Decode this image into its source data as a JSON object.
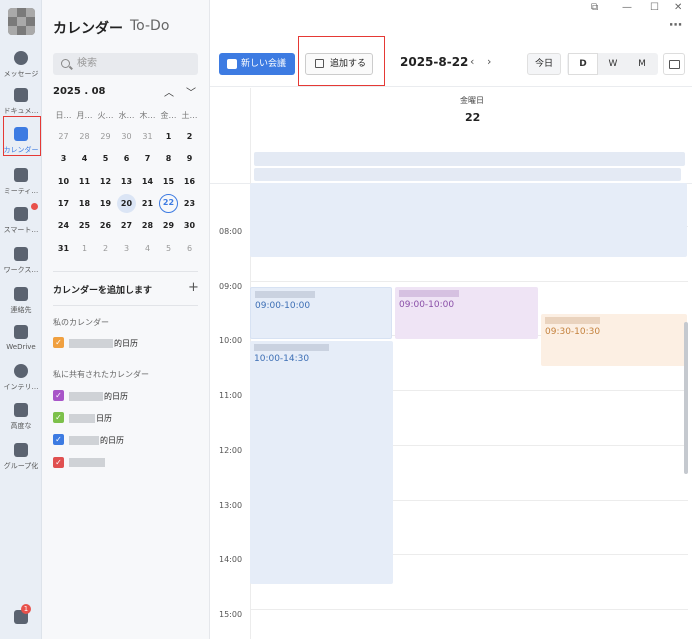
{
  "sidebar_rail": {
    "items": [
      {
        "label": "メッセージ",
        "icon": "chat-icon"
      },
      {
        "label": "ドキュメ…",
        "icon": "document-icon"
      },
      {
        "label": "カレンダー",
        "icon": "calendar-icon"
      },
      {
        "label": "ミーティ…",
        "icon": "meeting-icon"
      },
      {
        "label": "スマート…",
        "icon": "smart-icon"
      },
      {
        "label": "ワークス…",
        "icon": "workspace-icon"
      },
      {
        "label": "連絡先",
        "icon": "contacts-icon"
      },
      {
        "label": "WeDrive",
        "icon": "drive-icon"
      },
      {
        "label": "インテリ…",
        "icon": "intelligence-icon"
      },
      {
        "label": "高度な",
        "icon": "advanced-icon"
      },
      {
        "label": "グループ化",
        "icon": "group-icon"
      }
    ],
    "bottom_badge": "1"
  },
  "panel": {
    "tab_calendar": "カレンダー",
    "tab_todo": "To-Do",
    "search_placeholder": "検索",
    "month_label": "2025 . 08",
    "weekdays": [
      "日…",
      "月…",
      "火…",
      "水…",
      "木…",
      "金…",
      "土…"
    ],
    "weeks": [
      [
        "27",
        "28",
        "29",
        "30",
        "31",
        "1",
        "2"
      ],
      [
        "3",
        "4",
        "5",
        "6",
        "7",
        "8",
        "9"
      ],
      [
        "10",
        "11",
        "12",
        "13",
        "14",
        "15",
        "16"
      ],
      [
        "17",
        "18",
        "19",
        "20",
        "21",
        "22",
        "23"
      ],
      [
        "24",
        "25",
        "26",
        "27",
        "28",
        "29",
        "30"
      ],
      [
        "31",
        "1",
        "2",
        "3",
        "4",
        "5",
        "6"
      ]
    ],
    "add_calendar": "カレンダーを追加します",
    "my_calendars_title": "私のカレンダー",
    "my_calendars": [
      {
        "name": "的日历",
        "color": "#f0a040"
      }
    ],
    "shared_title": "私に共有されたカレンダー",
    "shared_calendars": [
      {
        "name": "的日历",
        "color": "#a855c8"
      },
      {
        "name": "日历",
        "color": "#7cc04a"
      },
      {
        "name": "的日历",
        "color": "#3d7be2"
      },
      {
        "name": "",
        "color": "#e05050"
      }
    ]
  },
  "toolbar": {
    "new_meeting": "新しい会議",
    "add": "追加する",
    "date": "2025-8-22",
    "today": "今日",
    "views": [
      "D",
      "W",
      "M"
    ],
    "active_view": "D"
  },
  "day_header": {
    "weekday": "金曜日",
    "day": "22"
  },
  "hours": [
    "08:00",
    "09:00",
    "10:00",
    "11:00",
    "12:00",
    "13:00",
    "14:00",
    "15:00"
  ],
  "events": [
    {
      "time": "09:00-10:00",
      "color": "#e6edf8"
    },
    {
      "time": "09:00-10:00",
      "color": "#efe4f5"
    },
    {
      "time": "09:30-10:30",
      "color": "#fcefe3"
    },
    {
      "time": "10:00-14:30",
      "color": "#e6edf8"
    }
  ]
}
